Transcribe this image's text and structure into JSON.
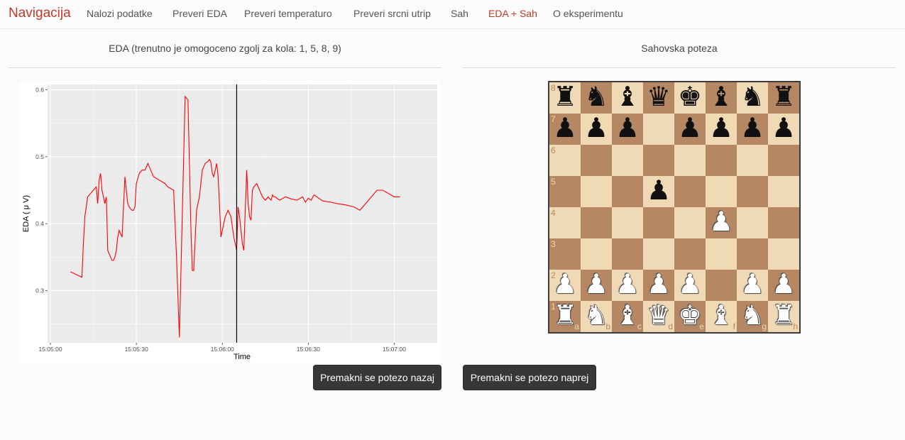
{
  "navbar": {
    "brand": "Navigacija",
    "items": [
      {
        "label": "Nalozi podatke",
        "active": false
      },
      {
        "label": "Preveri EDA",
        "active": false
      },
      {
        "label": "Preveri temperaturo",
        "active": false
      },
      {
        "label": "Preveri srcni utrip",
        "active": false
      },
      {
        "label": "Sah",
        "active": false
      },
      {
        "label": "EDA + Sah",
        "active": true
      },
      {
        "label": "O eksperimentu",
        "active": false
      }
    ]
  },
  "left_panel": {
    "title": "EDA (trenutno je omogoceno zgolj za kola: 1, 5, 8, 9)"
  },
  "right_panel": {
    "title": "Sahovska poteza"
  },
  "chart_data": {
    "type": "line",
    "xlabel": "Time",
    "ylabel": "EDA ( μ V)",
    "x_ticks": [
      "15:05:00",
      "15:05:30",
      "15:06:00",
      "15:06:30",
      "15:07:00"
    ],
    "y_ticks": [
      "0.3",
      "0.4",
      "0.5",
      "0.6"
    ],
    "xlim_seconds_after_15_05_00": [
      -1,
      135
    ],
    "ylim": [
      0.222,
      0.608
    ],
    "grid": true,
    "line_color": "#ff0000",
    "marker_line_color": "#000000",
    "marker_x_seconds_after_15_05_00": 65,
    "series": [
      {
        "x_seconds_after_15_05_00": [
          7,
          8,
          10,
          11,
          11.5,
          12,
          13,
          15,
          16,
          16.5,
          17,
          17.5,
          18,
          18.5,
          19,
          19.5,
          20,
          21,
          21.5,
          22,
          22.5,
          23,
          23.5,
          24,
          25,
          26,
          27,
          27.5,
          28,
          28.5,
          29,
          29.5,
          30,
          31,
          32,
          33,
          33.5,
          34,
          35,
          36,
          38,
          40,
          41,
          43,
          44,
          45,
          47,
          48,
          49,
          49.5,
          50,
          51,
          52,
          52.5,
          53,
          54,
          55,
          55.5,
          56,
          56.5,
          57,
          57.5,
          58,
          58.5,
          59,
          59.5,
          60,
          61,
          62,
          63,
          64,
          65,
          65.5,
          66,
          66.5,
          67,
          67.5,
          68,
          68.5,
          69,
          69.5,
          70,
          70.5,
          71,
          72,
          73,
          74,
          75,
          76,
          77,
          77.5,
          78,
          78.5,
          79,
          80,
          82,
          84,
          86,
          88,
          89,
          90,
          91,
          92,
          95,
          98,
          100,
          103,
          106,
          108,
          110,
          112,
          114,
          116,
          118,
          120,
          122,
          122.5,
          123,
          124,
          125,
          126,
          127,
          128
        ],
        "y_values": [
          0.328,
          0.326,
          0.322,
          0.32,
          0.37,
          0.41,
          0.44,
          0.45,
          0.455,
          0.43,
          0.465,
          0.475,
          0.45,
          0.44,
          0.43,
          0.44,
          0.36,
          0.35,
          0.345,
          0.345,
          0.35,
          0.36,
          0.38,
          0.39,
          0.38,
          0.47,
          0.43,
          0.425,
          0.422,
          0.42,
          0.42,
          0.425,
          0.46,
          0.475,
          0.48,
          0.48,
          0.485,
          0.49,
          0.48,
          0.47,
          0.465,
          0.46,
          0.455,
          0.45,
          0.35,
          0.23,
          0.59,
          0.585,
          0.4,
          0.33,
          0.33,
          0.42,
          0.44,
          0.46,
          0.48,
          0.49,
          0.493,
          0.496,
          0.492,
          0.475,
          0.47,
          0.48,
          0.49,
          0.472,
          0.43,
          0.38,
          0.39,
          0.41,
          0.42,
          0.41,
          0.38,
          0.36,
          0.425,
          0.41,
          0.39,
          0.37,
          0.36,
          0.42,
          0.48,
          0.43,
          0.41,
          0.405,
          0.45,
          0.455,
          0.46,
          0.45,
          0.44,
          0.435,
          0.44,
          0.435,
          0.443,
          0.44,
          0.44,
          0.438,
          0.435,
          0.44,
          0.437,
          0.435,
          0.44,
          0.432,
          0.438,
          0.435,
          0.443,
          0.434,
          0.432,
          0.43,
          0.428,
          0.425,
          0.42,
          0.43,
          0.44,
          0.45,
          0.45,
          0.445,
          0.44,
          0.44
        ]
      }
    ]
  },
  "chess": {
    "ranks": [
      "8",
      "7",
      "6",
      "5",
      "4",
      "3",
      "2",
      "1"
    ],
    "files": [
      "a",
      "b",
      "c",
      "d",
      "e",
      "f",
      "g",
      "h"
    ],
    "rows": [
      [
        "br",
        "bn",
        "bb",
        "bq",
        "bk",
        "bb",
        "bn",
        "br"
      ],
      [
        "bp",
        "bp",
        "bp",
        "",
        "bp",
        "bp",
        "bp",
        "bp"
      ],
      [
        "",
        "",
        "",
        "",
        "",
        "",
        "",
        ""
      ],
      [
        "",
        "",
        "",
        "bp",
        "",
        "",
        "",
        ""
      ],
      [
        "",
        "",
        "",
        "",
        "",
        "wp",
        "",
        ""
      ],
      [
        "",
        "",
        "",
        "",
        "",
        "",
        "",
        ""
      ],
      [
        "wp",
        "wp",
        "wp",
        "wp",
        "wp",
        "",
        "wp",
        "wp"
      ],
      [
        "wr",
        "wn",
        "wb",
        "wq",
        "wk",
        "wb",
        "wn",
        "wr"
      ]
    ]
  },
  "buttons": {
    "back": "Premakni se potezo nazaj",
    "forward": "Premakni se potezo naprej"
  }
}
